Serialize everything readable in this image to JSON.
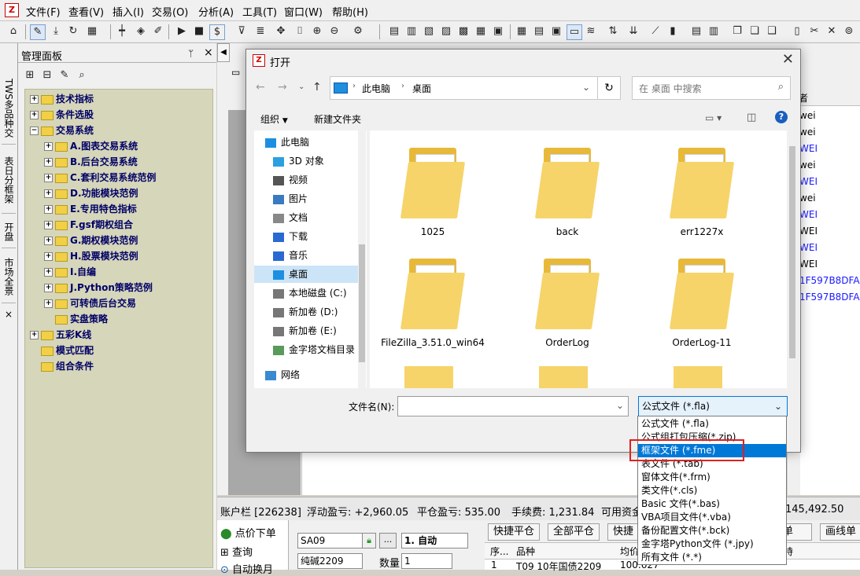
{
  "menubar": {
    "items": [
      "文件(F)",
      "查看(V)",
      "插入(I)",
      "交易(O)",
      "分析(A)",
      "工具(T)",
      "窗口(W)",
      "帮助(H)"
    ]
  },
  "vtabs": [
    "TWS多品种交",
    "表日分框架",
    "开盘",
    "市场全景"
  ],
  "vtab_close": "×",
  "panel": {
    "title": "管理面板",
    "pin": "ᛘ",
    "close": "×"
  },
  "tree": [
    {
      "label": "技术指标",
      "toggle": "+",
      "level": 0
    },
    {
      "label": "条件选股",
      "toggle": "+",
      "level": 0
    },
    {
      "label": "交易系统",
      "toggle": "−",
      "level": 0
    },
    {
      "label": "A.图表交易系统",
      "toggle": "+",
      "level": 1
    },
    {
      "label": "B.后台交易系统",
      "toggle": "+",
      "level": 1
    },
    {
      "label": "C.套利交易系统范例",
      "toggle": "+",
      "level": 1
    },
    {
      "label": "D.功能模块范例",
      "toggle": "+",
      "level": 1
    },
    {
      "label": "E.专用特色指标",
      "toggle": "+",
      "level": 1
    },
    {
      "label": "F.gsf期权组合",
      "toggle": "+",
      "level": 1
    },
    {
      "label": "G.期权模块范例",
      "toggle": "+",
      "level": 1
    },
    {
      "label": "H.股票模块范例",
      "toggle": "+",
      "level": 1
    },
    {
      "label": "I.自编",
      "toggle": "+",
      "level": 1
    },
    {
      "label": "J.Python策略范例",
      "toggle": "+",
      "level": 1
    },
    {
      "label": "可转债后台交易",
      "toggle": "+",
      "level": 1
    },
    {
      "label": "实盘策略",
      "toggle": "",
      "level": 1
    },
    {
      "label": "五彩K线",
      "toggle": "+",
      "level": 0
    },
    {
      "label": "模式匹配",
      "toggle": "",
      "level": 0
    },
    {
      "label": "组合条件",
      "toggle": "",
      "level": 0
    }
  ],
  "right_column": {
    "header": "者",
    "rows": [
      "wei",
      "wei",
      "WEI",
      "wei",
      "WEI",
      "wei",
      "WEI",
      "WEI",
      "WEI",
      "WEI",
      "1F597B8DFAD",
      "1F597B8DFAD"
    ]
  },
  "account_bar": {
    "label": "账户栏 [226238]",
    "floating": "浮动盈亏: +2,960.05",
    "closed": "平仓盈亏: 535.00",
    "fee": "手续费: 1,231.84",
    "available": "可用资金",
    "amount": "145,492.50"
  },
  "bottom": {
    "left_items": [
      "点价下单",
      "查询",
      "自动换月"
    ],
    "code": "SA09",
    "mode": "1. 自动",
    "name": "纯碱2209",
    "qty_label": "数量",
    "qty": "1",
    "buttons": [
      "快捷平仓",
      "全部平仓",
      "快捷",
      "单",
      "画线单"
    ],
    "col_headers": [
      "序...",
      "品种",
      "均价",
      "持"
    ],
    "row": [
      "1",
      "T09 10年国债2209",
      "100.627"
    ]
  },
  "dialog": {
    "title": "打开",
    "breadcrumb": [
      "此电脑",
      "桌面"
    ],
    "search_placeholder": "在 桌面 中搜索",
    "organize": "组织",
    "new_folder": "新建文件夹",
    "nav_items": [
      "此电脑",
      "3D 对象",
      "视频",
      "图片",
      "文档",
      "下载",
      "音乐",
      "桌面",
      "本地磁盘 (C:)",
      "新加卷 (D:)",
      "新加卷 (E:)",
      "金字塔文档目录",
      "网络"
    ],
    "folders": [
      "1025",
      "back",
      "err1227x",
      "FileZilla_3.51.0_win64",
      "OrderLog",
      "OrderLog-11"
    ],
    "filename_label": "文件名(N):",
    "filename_value": "",
    "filetype_value": "公式文件 (*.fla)"
  },
  "filetype_options": [
    "公式文件 (*.fla)",
    "公式组打包压缩(*.zip)",
    "框架文件 (*.fme)",
    "表文件 (*.tab)",
    "窗体文件(*.frm)",
    "类文件(*.cls)",
    "Basic 文件(*.bas)",
    "VBA项目文件(*.vba)",
    "备份配置文件(*.bck)",
    "金字塔Python文件 (*.jpy)",
    "所有文件 (*.*)"
  ],
  "selected_option": "框架文件 (*.fme)",
  "colors": {
    "selection": "#0078d7",
    "tree_bg": "#d6d6ba",
    "highlight_box": "#e02020",
    "link_blue": "#1a1aff"
  }
}
